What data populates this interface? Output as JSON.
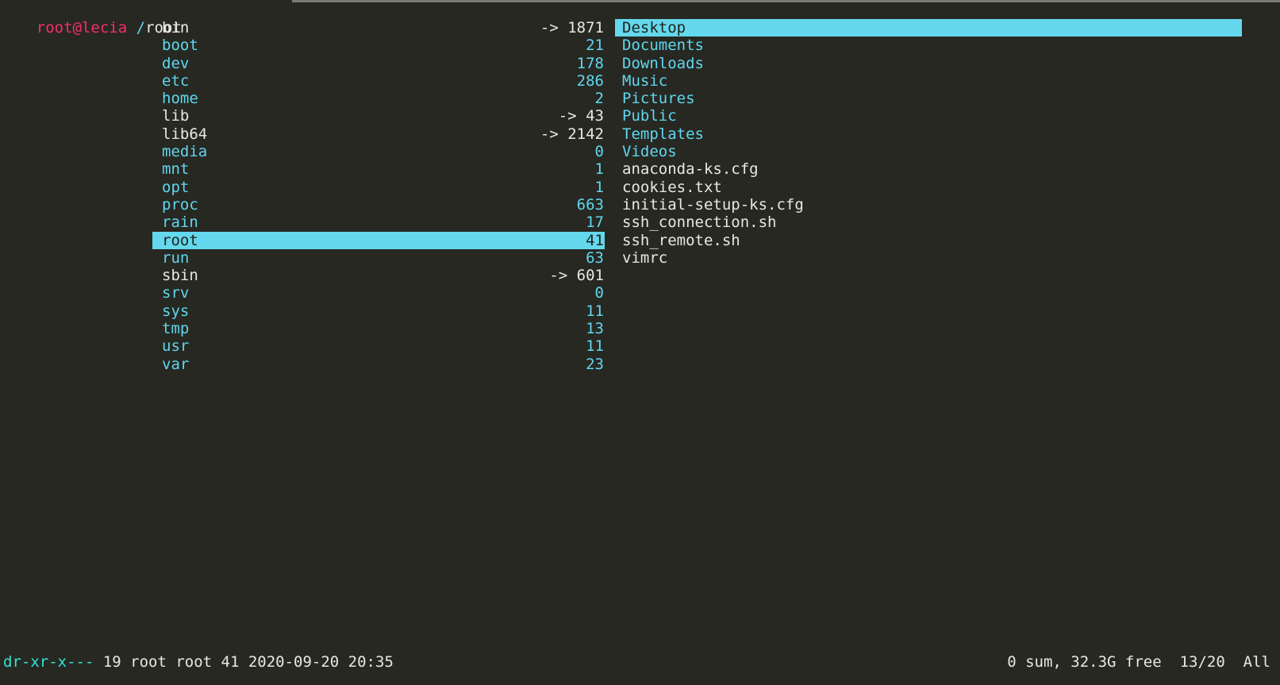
{
  "terminal": {
    "background_color": "#272822",
    "foreground_color": "#e8e8e2",
    "dir_color": "#5fd7ef",
    "selection_color": "#64d8ec",
    "user_color": "#f52f69",
    "perm_color": "#2ee6d6"
  },
  "header": {
    "user_host": "root@lecia",
    "path_slash": "/",
    "path_name": "root"
  },
  "left_pane": {
    "path": "/",
    "rows": [
      {
        "name": "bin",
        "size": "-> 1871",
        "kind": "link"
      },
      {
        "name": "boot",
        "size": "21",
        "kind": "dir"
      },
      {
        "name": "dev",
        "size": "178",
        "kind": "dir"
      },
      {
        "name": "etc",
        "size": "286",
        "kind": "dir"
      },
      {
        "name": "home",
        "size": "2",
        "kind": "dir"
      },
      {
        "name": "lib",
        "size": "-> 43",
        "kind": "link"
      },
      {
        "name": "lib64",
        "size": "-> 2142",
        "kind": "link"
      },
      {
        "name": "media",
        "size": "0",
        "kind": "dir"
      },
      {
        "name": "mnt",
        "size": "1",
        "kind": "dir"
      },
      {
        "name": "opt",
        "size": "1",
        "kind": "dir"
      },
      {
        "name": "proc",
        "size": "663",
        "kind": "dir"
      },
      {
        "name": "rain",
        "size": "17",
        "kind": "dir"
      },
      {
        "name": "root",
        "size": "41",
        "kind": "dir",
        "selected": true
      },
      {
        "name": "run",
        "size": "63",
        "kind": "dir"
      },
      {
        "name": "sbin",
        "size": "-> 601",
        "kind": "link"
      },
      {
        "name": "srv",
        "size": "0",
        "kind": "dir"
      },
      {
        "name": "sys",
        "size": "11",
        "kind": "dir"
      },
      {
        "name": "tmp",
        "size": "13",
        "kind": "dir"
      },
      {
        "name": "usr",
        "size": "11",
        "kind": "dir"
      },
      {
        "name": "var",
        "size": "23",
        "kind": "dir"
      }
    ]
  },
  "right_pane": {
    "path": "/root",
    "rows": [
      {
        "name": "Desktop",
        "kind": "dir",
        "selected": true
      },
      {
        "name": "Documents",
        "kind": "dir"
      },
      {
        "name": "Downloads",
        "kind": "dir"
      },
      {
        "name": "Music",
        "kind": "dir"
      },
      {
        "name": "Pictures",
        "kind": "dir"
      },
      {
        "name": "Public",
        "kind": "dir"
      },
      {
        "name": "Templates",
        "kind": "dir"
      },
      {
        "name": "Videos",
        "kind": "dir"
      },
      {
        "name": "anaconda-ks.cfg",
        "kind": "file"
      },
      {
        "name": "cookies.txt",
        "kind": "file"
      },
      {
        "name": "initial-setup-ks.cfg",
        "kind": "file"
      },
      {
        "name": "ssh_connection.sh",
        "kind": "file"
      },
      {
        "name": "ssh_remote.sh",
        "kind": "file"
      },
      {
        "name": "vimrc",
        "kind": "file"
      }
    ]
  },
  "status_bar": {
    "permissions": "dr-xr-x---",
    "details": " 19 root root 41 2020-09-20 20:35",
    "disk_usage": "0 sum, 32.3G free",
    "position": "13/20",
    "scroll": "All"
  }
}
